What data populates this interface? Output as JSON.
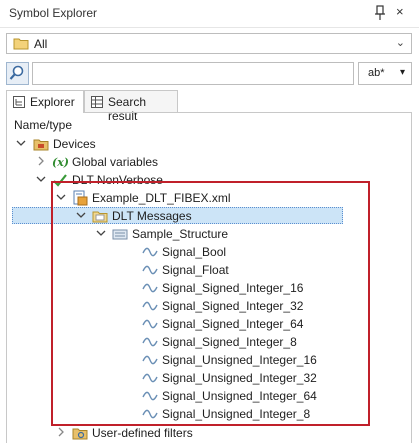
{
  "window": {
    "title": "Symbol Explorer",
    "pin_icon": "pin-icon",
    "close_glyph": "×"
  },
  "filter_combo": {
    "value": "All",
    "arrow": "⌄"
  },
  "search": {
    "value": "",
    "mode_label": "ab*",
    "mode_arrow": "▾"
  },
  "tabs": [
    {
      "label": "Explorer",
      "active": true
    },
    {
      "label": "Search result",
      "active": false
    }
  ],
  "tree": {
    "column_header": "Name/type",
    "rows": [
      {
        "label": "Devices",
        "icon": "devices-folder-icon",
        "expander": "expanded"
      },
      {
        "label": "Global variables",
        "icon": "global-variables-icon",
        "expander": "collapsed"
      },
      {
        "label": "DLT NonVerbose",
        "icon": "dlt-nonverbose-icon",
        "expander": "expanded"
      },
      {
        "label": "Example_DLT_FIBEX.xml",
        "icon": "fibex-file-icon",
        "expander": "expanded"
      },
      {
        "label": "DLT Messages",
        "icon": "dlt-messages-folder-icon",
        "expander": "expanded",
        "selected": true
      },
      {
        "label": "Sample_Structure",
        "icon": "structure-icon",
        "expander": "expanded"
      },
      {
        "label": "Signal_Bool",
        "icon": "signal-icon",
        "expander": "none"
      },
      {
        "label": "Signal_Float",
        "icon": "signal-icon",
        "expander": "none"
      },
      {
        "label": "Signal_Signed_Integer_16",
        "icon": "signal-icon",
        "expander": "none"
      },
      {
        "label": "Signal_Signed_Integer_32",
        "icon": "signal-icon",
        "expander": "none"
      },
      {
        "label": "Signal_Signed_Integer_64",
        "icon": "signal-icon",
        "expander": "none"
      },
      {
        "label": "Signal_Signed_Integer_8",
        "icon": "signal-icon",
        "expander": "none"
      },
      {
        "label": "Signal_Unsigned_Integer_16",
        "icon": "signal-icon",
        "expander": "none"
      },
      {
        "label": "Signal_Unsigned_Integer_32",
        "icon": "signal-icon",
        "expander": "none"
      },
      {
        "label": "Signal_Unsigned_Integer_64",
        "icon": "signal-icon",
        "expander": "none"
      },
      {
        "label": "Signal_Unsigned_Integer_8",
        "icon": "signal-icon",
        "expander": "none"
      },
      {
        "label": "User-defined filters",
        "icon": "filter-folder-icon",
        "expander": "collapsed"
      }
    ]
  },
  "colors": {
    "selection": "#cce4f7",
    "highlight_box": "#c0202a",
    "signal": "#6a8fb5"
  }
}
